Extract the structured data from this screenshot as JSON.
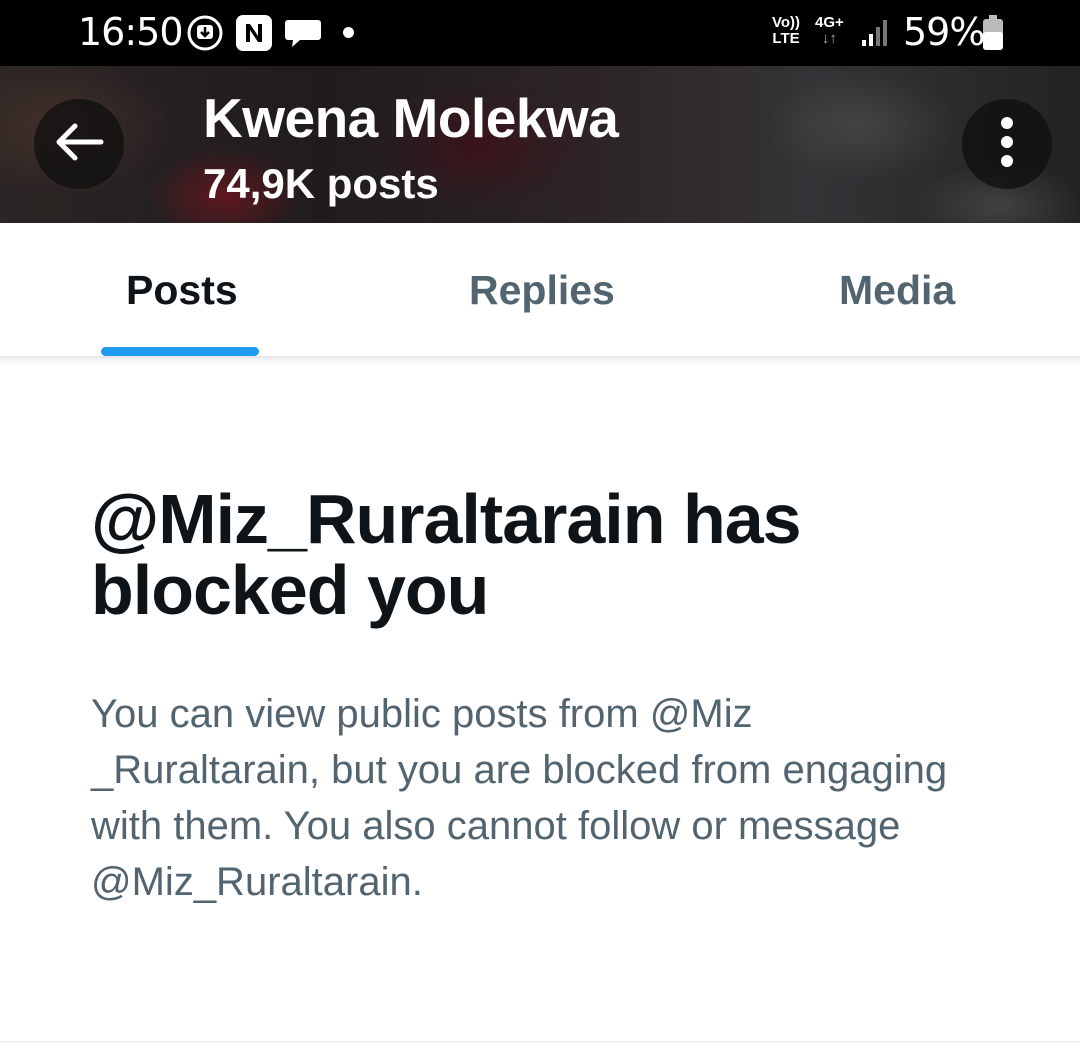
{
  "status_bar": {
    "time": "16:50",
    "notification_icons": [
      "download-icon",
      "n-app-icon",
      "chat-bubble-icon",
      "dot-icon"
    ],
    "volte_top": "Vo))",
    "volte_bottom": "LTE",
    "network_top": "4G+",
    "network_bottom": "↓↑",
    "signal_icon": "signal-bars-icon",
    "battery_percent": "59%",
    "battery_level": 0.59
  },
  "header": {
    "back_icon": "arrow-left-icon",
    "name": "Kwena Molekwa",
    "post_count": "74,9K posts",
    "more_icon": "more-vertical-icon"
  },
  "tabs": [
    {
      "label": "Posts",
      "active": true
    },
    {
      "label": "Replies",
      "active": false
    },
    {
      "label": "Media",
      "active": false
    }
  ],
  "blocked": {
    "title": "@Miz_Ruraltarain has blocked you",
    "description": "You can view public posts from @Miz _Ruraltarain, but you are blocked from engaging with them. You also cannot follow or message @Miz_Ruraltarain."
  },
  "colors": {
    "accent": "#1d9bf0",
    "primary_text": "#0f1419",
    "secondary_text": "#536471"
  }
}
